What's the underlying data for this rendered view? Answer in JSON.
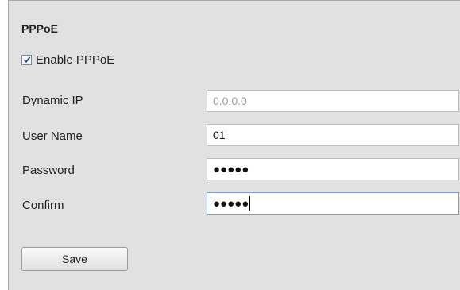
{
  "section": {
    "title": "PPPoE"
  },
  "enable_pppoe": {
    "label": "Enable PPPoE",
    "checked": true
  },
  "fields": {
    "dynamic_ip": {
      "label": "Dynamic IP",
      "value": "0.0.0.0"
    },
    "user_name": {
      "label": "User Name",
      "value": "01"
    },
    "password": {
      "label": "Password",
      "masked_value": "●●●●●"
    },
    "confirm": {
      "label": "Confirm",
      "masked_value": "●●●●●"
    }
  },
  "actions": {
    "save_label": "Save"
  }
}
